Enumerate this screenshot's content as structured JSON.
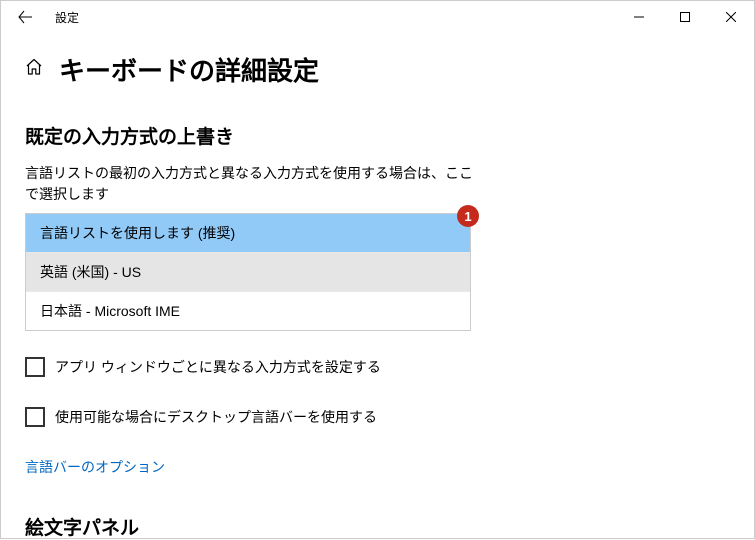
{
  "window": {
    "title": "設定"
  },
  "page": {
    "title": "キーボードの詳細設定"
  },
  "override_section": {
    "title": "既定の入力方式の上書き",
    "description": "言語リストの最初の入力方式と異なる入力方式を使用する場合は、ここで選択します",
    "badge": "1",
    "options": [
      "言語リストを使用します (推奨)",
      "英語 (米国) - US",
      "日本語 - Microsoft IME"
    ]
  },
  "checkboxes": {
    "per_window": "アプリ ウィンドウごとに異なる入力方式を設定する",
    "desktop_bar": "使用可能な場合にデスクトップ言語バーを使用する"
  },
  "link": {
    "language_bar_options": "言語バーのオプション"
  },
  "emoji_section": {
    "title": "絵文字パネル"
  }
}
